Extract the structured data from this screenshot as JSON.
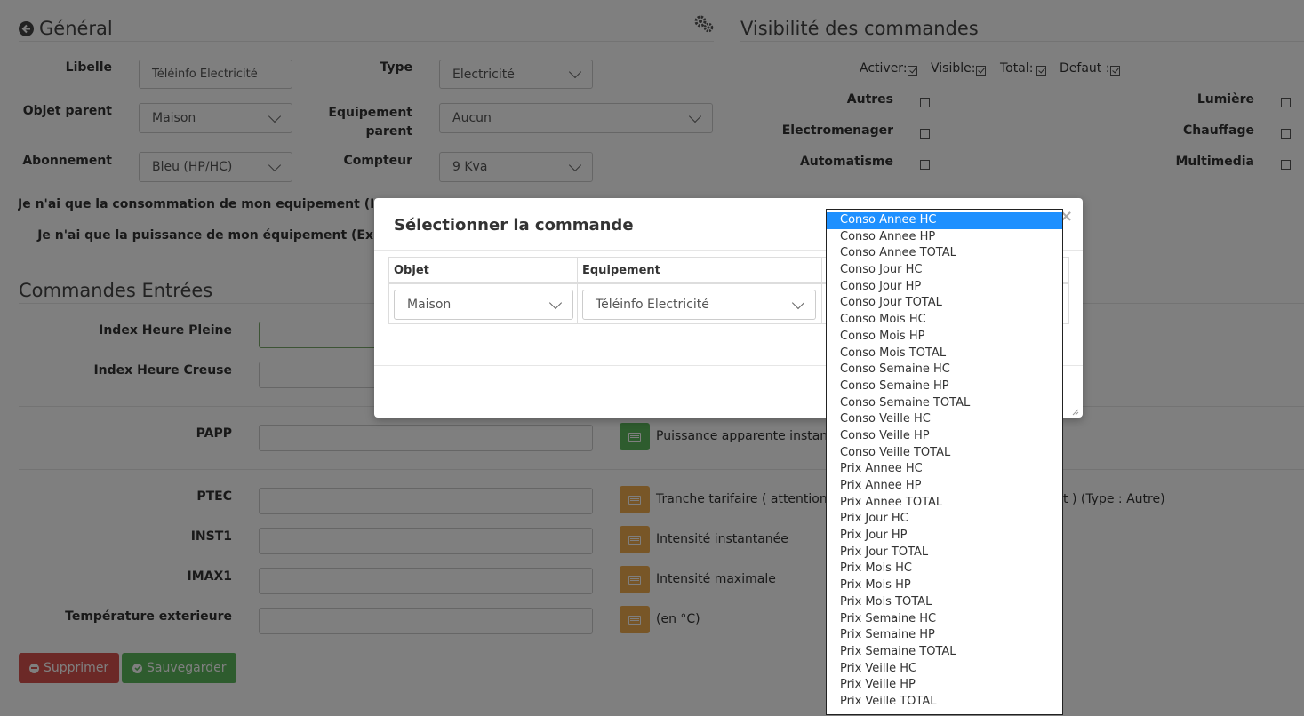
{
  "general": {
    "title": "Général",
    "libelle_label": "Libelle",
    "libelle_value": "Téléinfo Electricité",
    "type_label": "Type",
    "type_value": "Electricité",
    "objet_parent_label": "Objet parent",
    "objet_parent_value": "Maison",
    "equipement_parent_label_1": "Equipement",
    "equipement_parent_label_2": "parent",
    "equipement_parent_value": "Aucun",
    "abonnement_label": "Abonnement",
    "abonnement_value": "Bleu (HP/HC)",
    "compteur_label": "Compteur",
    "compteur_value": "9 Kva",
    "conso_only_label": "Je n'ai que la consommation de mon equipement (Ex",
    "puissance_only_label": "Je n'ai que la puissance de mon équipement (Ex"
  },
  "visibility": {
    "title": "Visibilité des commandes",
    "activer": "Activer:",
    "visible": "Visible:",
    "total": "Total:",
    "defaut": "Defaut :",
    "autres": "Autres",
    "electromenager": "Electromenager",
    "automatisme": "Automatisme",
    "lumiere": "Lumière",
    "chauffage": "Chauffage",
    "multimedia": "Multimedia"
  },
  "commandes": {
    "title": "Commandes Entrées",
    "index_hp": "Index Heure Pleine",
    "index_hc": "Index Heure Creuse",
    "papp": "PAPP",
    "papp_desc": "Puissance apparente instantan",
    "ptec": "PTEC",
    "ptec_desc_start": "Tranche tarifaire ( attention c",
    "ptec_desc_end": "t ) (Type : Autre)",
    "inst1": "INST1",
    "inst1_desc": "Intensité instantanée",
    "imax1": "IMAX1",
    "imax1_desc": "Intensité maximale",
    "temp": "Température exterieure",
    "temp_desc": "(en °C)"
  },
  "actions": {
    "delete": "Supprimer",
    "save": "Sauvegarder"
  },
  "modal": {
    "title": "Sélectionner la commande",
    "close": "×",
    "col_objet": "Objet",
    "col_equipement": "Equipement",
    "objet_value": "Maison",
    "equipement_value": "Téléinfo Electricité"
  },
  "dropdown": {
    "selected_index": 0,
    "options": [
      "Conso Annee HC",
      "Conso Annee HP",
      "Conso Annee TOTAL",
      "Conso Jour HC",
      "Conso Jour HP",
      "Conso Jour TOTAL",
      "Conso Mois HC",
      "Conso Mois HP",
      "Conso Mois TOTAL",
      "Conso Semaine HC",
      "Conso Semaine HP",
      "Conso Semaine TOTAL",
      "Conso Veille HC",
      "Conso Veille HP",
      "Conso Veille TOTAL",
      "Prix Annee HC",
      "Prix Annee HP",
      "Prix Annee TOTAL",
      "Prix Jour HC",
      "Prix Jour HP",
      "Prix Jour TOTAL",
      "Prix Mois HC",
      "Prix Mois HP",
      "Prix Mois TOTAL",
      "Prix Semaine HC",
      "Prix Semaine HP",
      "Prix Semaine TOTAL",
      "Prix Veille HC",
      "Prix Veille HP",
      "Prix Veille TOTAL"
    ]
  },
  "colors": {
    "green_btn": "#5cb85c",
    "orange_btn": "#f0ad4e",
    "red_btn": "#d9534f",
    "selected_option": "#1e90ff"
  }
}
